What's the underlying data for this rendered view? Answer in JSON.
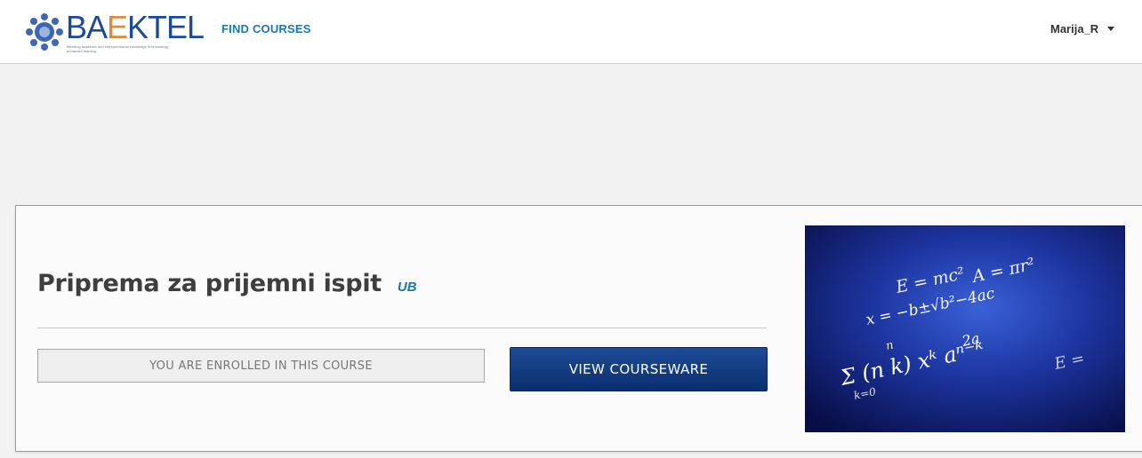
{
  "header": {
    "logo": {
      "name_prefix": "BA",
      "name_accent": "E",
      "name_suffix": "KTEL",
      "tagline": "Blending academic and entrepreneurial knowledge in technology enhanced learning"
    },
    "nav": {
      "find_courses": "FIND COURSES"
    },
    "user": {
      "username": "Marija_R",
      "menu_icon": "caret-down-icon"
    }
  },
  "course": {
    "title": "Priprema za prijemni ispit",
    "org": "UB",
    "enrolled_text": "YOU ARE ENROLLED IN THIS COURSE",
    "view_button": "VIEW COURSEWARE",
    "image": {
      "formulas": [
        "E = mc²",
        "A = πr²",
        "x = −b±√b²−4ac",
        "2a",
        "Σ (n k) xᵏ aⁿ⁻ᵏ",
        "k=0",
        "n",
        "E ="
      ]
    }
  },
  "colors": {
    "link": "#1a76b2",
    "button": "#0b2f6e",
    "logo_blue": "#1c4a9a",
    "logo_accent": "#d98a3c"
  }
}
